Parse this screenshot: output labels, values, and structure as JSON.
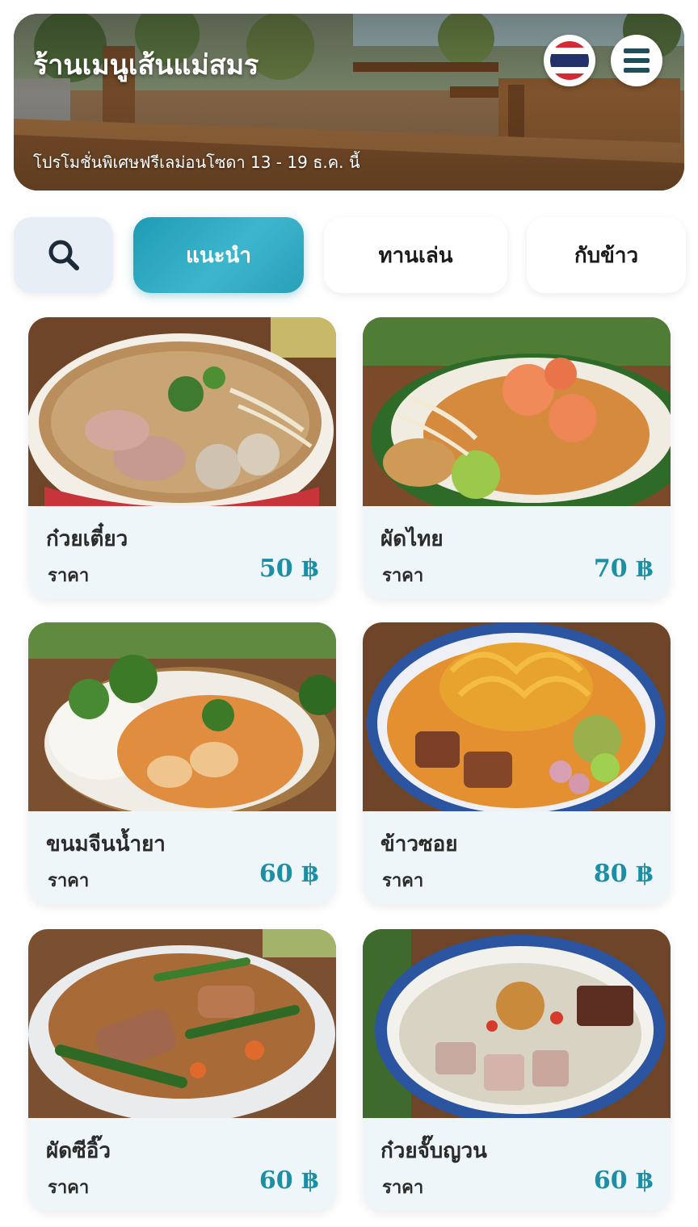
{
  "header": {
    "shop_name": "ร้านเมนูเส้นแม่สมร",
    "promo": "โปรโมชั่นพิเศษฟรีเลม่อนโซดา 13 - 19 ธ.ค. นี้",
    "language_flag": "thailand-flag-icon",
    "menu_icon": "hamburger-menu-icon"
  },
  "tabs": [
    {
      "label": "",
      "icon": "search-icon",
      "active": false
    },
    {
      "label": "แนะนำ",
      "active": true
    },
    {
      "label": "ทานเล่น",
      "active": false
    },
    {
      "label": "กับข้าว",
      "active": false
    }
  ],
  "menu_items": [
    {
      "name": "ก๋วยเตี๋ยว",
      "price_label": "ราคา",
      "price": "50 ฿",
      "image": "noodle-soup-photo"
    },
    {
      "name": "ผัดไทย",
      "price_label": "ราคา",
      "price": "70 ฿",
      "image": "pad-thai-photo"
    },
    {
      "name": "ขนมจีนน้ำยา",
      "price_label": "ราคา",
      "price": "60 ฿",
      "image": "khanom-jeen-photo"
    },
    {
      "name": "ข้าวซอย",
      "price_label": "ราคา",
      "price": "80 ฿",
      "image": "khao-soi-photo"
    },
    {
      "name": "ผัดซีอิ๊ว",
      "price_label": "ราคา",
      "price": "60 ฿",
      "image": "pad-see-ew-photo"
    },
    {
      "name": "ก๋วยจั๊บญวน",
      "price_label": "ราคา",
      "price": "60 ฿",
      "image": "kuay-jab-yuan-photo"
    }
  ],
  "colors": {
    "accent": "#2a9fb8",
    "price": "#1e8ea5",
    "card_bg": "#eff6f9",
    "search_tab_bg": "#e8eef6",
    "menu_icon": "#1d4e5a"
  }
}
